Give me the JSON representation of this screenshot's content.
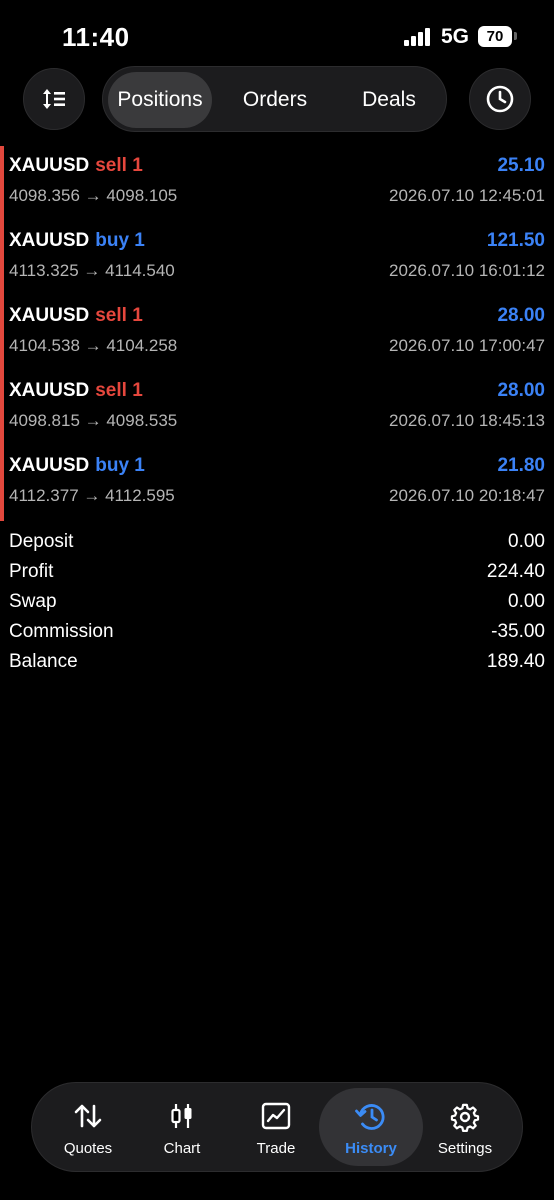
{
  "status_bar": {
    "time": "11:40",
    "network": "5G",
    "battery": "70"
  },
  "toolbar": {
    "sort_icon": "sort-icon",
    "tabs": [
      {
        "label": "Positions",
        "active": true
      },
      {
        "label": "Orders",
        "active": false
      },
      {
        "label": "Deals",
        "active": false
      }
    ],
    "history_icon": "clock-icon"
  },
  "deals": [
    {
      "symbol": "XAUUSD",
      "side": "sell 1",
      "type": "sell",
      "prices": "4098.356 → 4098.105",
      "profit": "25.10",
      "time": "2026.07.10 12:45:01"
    },
    {
      "symbol": "XAUUSD",
      "side": "buy 1",
      "type": "buy",
      "prices": "4113.325 → 4114.540",
      "profit": "121.50",
      "time": "2026.07.10 16:01:12"
    },
    {
      "symbol": "XAUUSD",
      "side": "sell 1",
      "type": "sell",
      "prices": "4104.538 → 4104.258",
      "profit": "28.00",
      "time": "2026.07.10 17:00:47"
    },
    {
      "symbol": "XAUUSD",
      "side": "sell 1",
      "type": "sell",
      "prices": "4098.815 → 4098.535",
      "profit": "28.00",
      "time": "2026.07.10 18:45:13"
    },
    {
      "symbol": "XAUUSD",
      "side": "buy 1",
      "type": "buy",
      "prices": "4112.377 → 4112.595",
      "profit": "21.80",
      "time": "2026.07.10 20:18:47"
    }
  ],
  "summary": [
    {
      "label": "Deposit",
      "value": "0.00"
    },
    {
      "label": "Profit",
      "value": "224.40"
    },
    {
      "label": "Swap",
      "value": "0.00"
    },
    {
      "label": "Commission",
      "value": "-35.00"
    },
    {
      "label": "Balance",
      "value": "189.40"
    }
  ],
  "tabbar": [
    {
      "label": "Quotes",
      "icon": "quotes-icon",
      "active": false
    },
    {
      "label": "Chart",
      "icon": "candlestick-icon",
      "active": false
    },
    {
      "label": "Trade",
      "icon": "trade-chart-icon",
      "active": false
    },
    {
      "label": "History",
      "icon": "history-icon",
      "active": true
    },
    {
      "label": "Settings",
      "icon": "gear-icon",
      "active": false
    }
  ],
  "colors": {
    "sell": "#e6473d",
    "buy": "#3b82f6",
    "profit": "#3b82f6",
    "active_tab": "#3b8cf6",
    "edge": "#e2483d"
  }
}
